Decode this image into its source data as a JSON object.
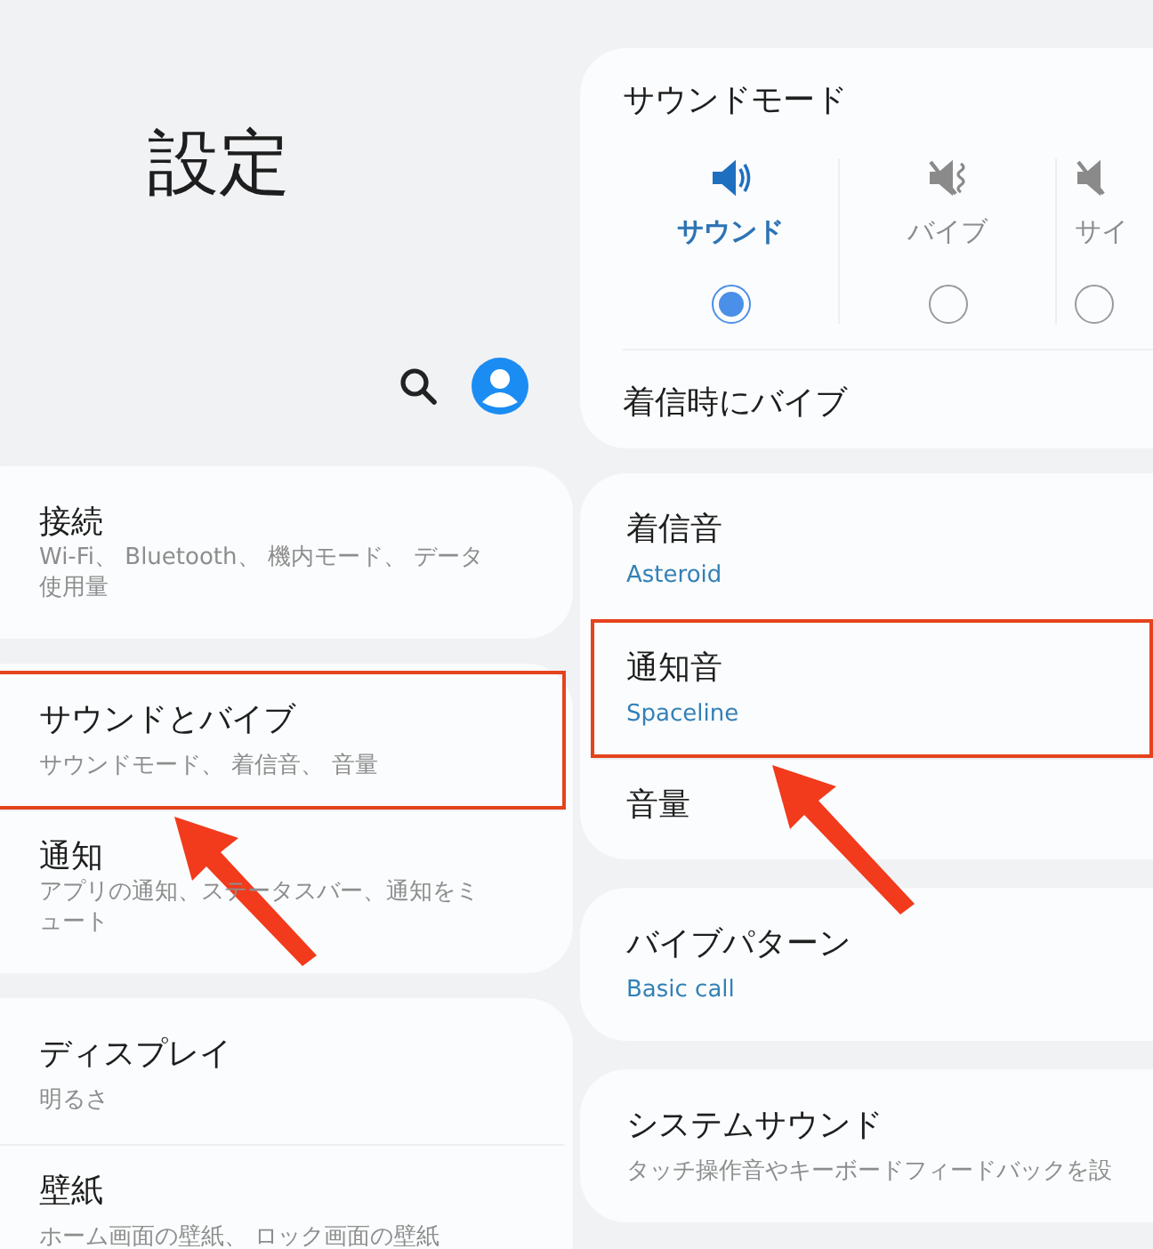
{
  "title": "設定",
  "left_groups": [
    {
      "items": [
        {
          "title": "接続",
          "subtitle": "Wi-Fi、 Bluetooth、 機内モード、 データ使用量",
          "highlighted": false
        }
      ]
    },
    {
      "items": [
        {
          "title": "サウンドとバイブ",
          "subtitle": "サウンドモード、 着信音、 音量",
          "highlighted": true
        },
        {
          "title": "通知",
          "subtitle": "アプリの通知、ステータスバー、通知をミュート",
          "highlighted": false
        }
      ]
    },
    {
      "items": [
        {
          "title": "ディスプレイ",
          "subtitle": "明るさ",
          "highlighted": false
        },
        {
          "title": "壁紙",
          "subtitle": "ホーム画面の壁紙、 ロック画面の壁紙",
          "highlighted": false
        }
      ]
    }
  ],
  "sound_mode": {
    "title": "サウンドモード",
    "options": [
      {
        "label": "サウンド",
        "selected": true,
        "kind": "sound"
      },
      {
        "label": "バイブ",
        "selected": false,
        "kind": "vibrate"
      },
      {
        "label": "サイ",
        "selected": false,
        "kind": "silent"
      }
    ],
    "vibrate_on_call": "着信時にバイブ"
  },
  "right_groups": [
    {
      "items": [
        {
          "title": "着信音",
          "value": "Asteroid",
          "highlighted": false
        },
        {
          "title": "通知音",
          "value": "Spaceline",
          "highlighted": true
        },
        {
          "title": "音量",
          "highlighted": false
        }
      ]
    },
    {
      "items": [
        {
          "title": "バイブパターン",
          "value": "Basic call",
          "highlighted": false
        }
      ]
    },
    {
      "items": [
        {
          "title": "システムサウンド",
          "subtitle": "タッチ操作音やキーボードフィードバックを設",
          "highlighted": false
        }
      ]
    }
  ]
}
